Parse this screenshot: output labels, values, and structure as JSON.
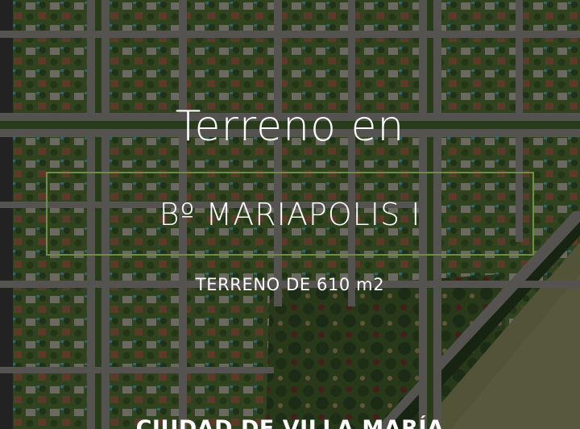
{
  "hero": {
    "title": "Terreno en",
    "neighborhood": "Bº MARIAPOLIS I",
    "subtitle": "TERRENO DE 610 m2",
    "city": "CIUDAD DE VILLA MARÍA"
  },
  "colors": {
    "frame_accent": "#6e8e45",
    "text": "#ffffff",
    "overlay": "#121412"
  },
  "background": {
    "subject": "aerial-photo-residential-neighborhood"
  }
}
